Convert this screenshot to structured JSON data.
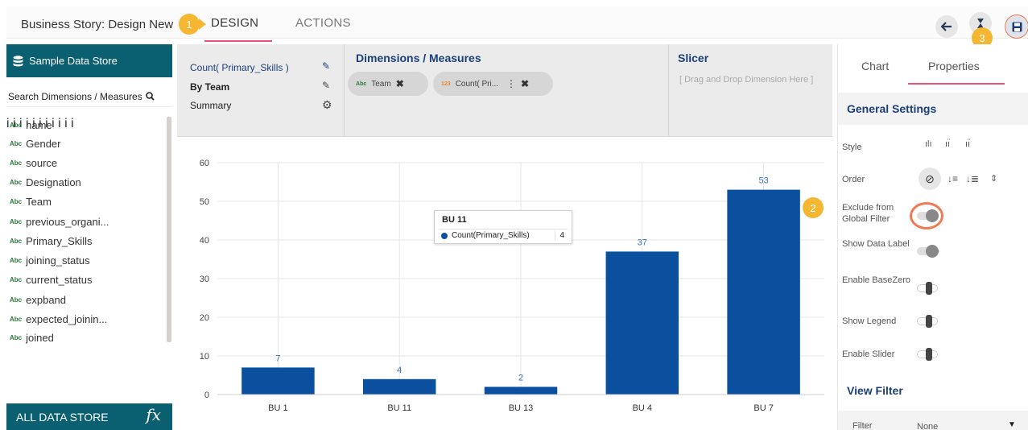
{
  "header": {
    "story_title": "Business Story: Design New",
    "tabs": [
      {
        "label": "DESIGN",
        "active": true
      },
      {
        "label": "ACTIONS",
        "active": false
      }
    ],
    "callouts": [
      "1",
      "2",
      "3"
    ],
    "buttons": {
      "back": "back-arrow-icon",
      "hourglass": "hourglass-icon",
      "save": "save-icon"
    }
  },
  "sidebar": {
    "title": "Sample Data Store",
    "search_placeholder": "Search Dimensions / Measures",
    "type_tag": "Abc",
    "info_glyph": "i",
    "fields": [
      "name",
      "Gender",
      "source",
      "Designation",
      "Team",
      "previous_organi...",
      "Primary_Skills",
      "joining_status",
      "current_status",
      "expband",
      "expected_joinin...",
      "joined"
    ],
    "footer_label": "ALL DATA STORE",
    "footer_icon": "fx"
  },
  "config": {
    "items": [
      "Count( Primary_Skills )",
      "By Team",
      "Summary"
    ],
    "dims_title": "Dimensions / Measures",
    "pills": [
      {
        "tag": "Abc",
        "label": "Team"
      },
      {
        "tag": "123",
        "label": "Count( Pri..."
      }
    ],
    "slicer_title": "Slicer",
    "slicer_hint": "[ Drag and Drop Dimension Here ]"
  },
  "chart_data": {
    "type": "bar",
    "categories": [
      "BU 1",
      "BU 11",
      "BU 13",
      "BU 4",
      "BU 7"
    ],
    "series": [
      {
        "name": "Count(Primary_Skills)",
        "values": [
          7,
          4,
          2,
          37,
          53
        ]
      }
    ],
    "data_labels": [
      "7",
      "4",
      "2",
      "37",
      "53"
    ],
    "ylim": [
      0,
      60
    ],
    "yticks": [
      0,
      10,
      20,
      30,
      40,
      50,
      60
    ],
    "grid": true,
    "color": "#0b4f9f",
    "label_color": "#3a72c4",
    "tooltip": {
      "title": "BU 11",
      "series": "Count(Primary_Skills)",
      "value": "4"
    }
  },
  "right_panel": {
    "tabs": [
      {
        "label": "Chart",
        "active": false
      },
      {
        "label": "Properties",
        "active": true
      }
    ],
    "general_settings_title": "General Settings",
    "settings": {
      "style": "Style",
      "order": "Order",
      "exclude": "Exclude from Global Filter",
      "show_data_label": "Show Data Label",
      "enable_basezero": "Enable BaseZero",
      "show_legend": "Show Legend",
      "enable_slider": "Enable Slider"
    },
    "toggles": {
      "exclude": true,
      "show_data_label": true,
      "enable_basezero": false,
      "show_legend": false,
      "enable_slider": false
    },
    "view_filter_title": "View Filter",
    "filter_label": "Filter",
    "filter_value": "None"
  }
}
